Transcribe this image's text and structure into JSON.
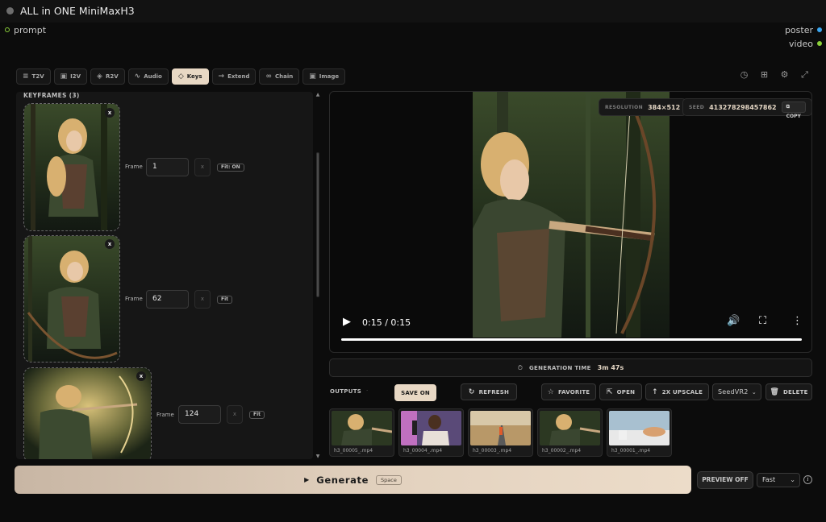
{
  "app": {
    "title": "ALL in ONE MiniMaxH3"
  },
  "ports": {
    "input": "prompt",
    "outputs": [
      "poster",
      "video"
    ]
  },
  "tabs": [
    {
      "label": "T2V",
      "icon": "text-lines-icon"
    },
    {
      "label": "I2V",
      "icon": "image-icon"
    },
    {
      "label": "R2V",
      "icon": "layers-icon"
    },
    {
      "label": "Audio",
      "icon": "waveform-icon"
    },
    {
      "label": "Keys",
      "icon": "diamond-icon",
      "active": true
    },
    {
      "label": "Extend",
      "icon": "arrow-right-icon"
    },
    {
      "label": "Chain",
      "icon": "link-icon"
    },
    {
      "label": "Image",
      "icon": "image-icon"
    }
  ],
  "keyframes": {
    "header": "KEYFRAMES (3)",
    "frame_label": "Frame",
    "close_label": "x",
    "items": [
      {
        "frame": "1",
        "clear": "x",
        "fit": "Fit: ON"
      },
      {
        "frame": "62",
        "clear": "x",
        "fit": "Fit"
      },
      {
        "frame": "124",
        "clear": "x",
        "fit": "Fit"
      }
    ]
  },
  "player": {
    "resolution_label": "RESOLUTION",
    "resolution": "384×512",
    "seed_label": "SEED",
    "seed": "413278298457862",
    "copy_label": "COPY",
    "time": "0:15 / 0:15",
    "progress": 1.0
  },
  "generation": {
    "label": "GENERATION TIME",
    "value": "3m 47s"
  },
  "outputs": {
    "label": "OUTPUTS",
    "dot": "·",
    "save": "SAVE ON",
    "refresh": "REFRESH",
    "favorite": "FAVORITE",
    "open": "OPEN",
    "upscale": "2X UPSCALE",
    "upscaler": "SeedVR2",
    "delete": "DELETE",
    "files": [
      "h3_00005_.mp4",
      "h3_00004_.mp4",
      "h3_00003_.mp4",
      "h3_00002_.mp4",
      "h3_00001_.mp4"
    ]
  },
  "footer": {
    "generate": "Generate",
    "shortcut": "Space",
    "preview": "PREVIEW OFF",
    "speed": "Fast",
    "info": "i"
  },
  "colors": {
    "accent": "#e8d8c4",
    "port_green": "#8bd03a",
    "port_blue": "#3aa6f0",
    "background": "#0c0c0c"
  }
}
